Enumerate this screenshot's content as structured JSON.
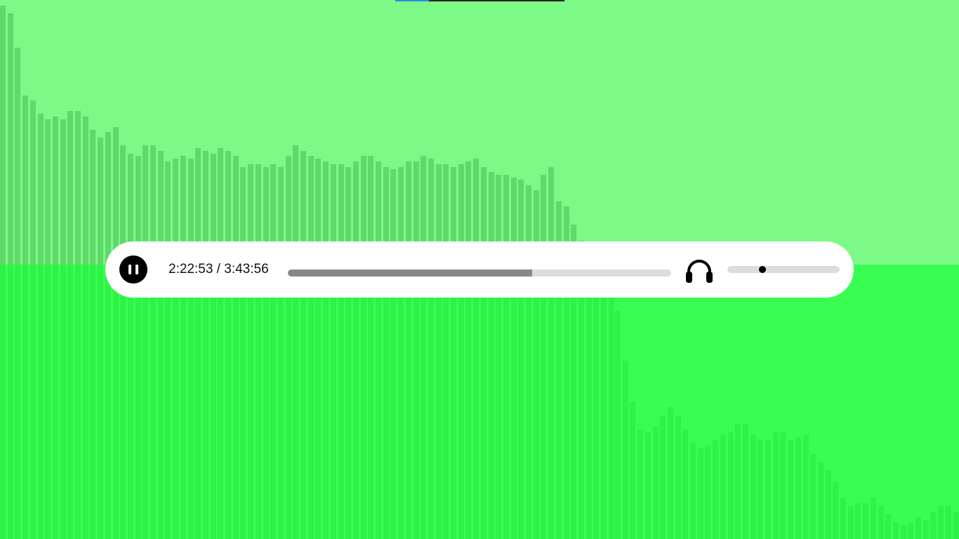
{
  "theme": {
    "bg_top": "#7cf987",
    "bg_bottom": "#3afd51",
    "bar_top": "#5fd96b",
    "bar_bottom": "#2ff247",
    "strip_accent": "#2b8be0",
    "strip_dark": "#222222",
    "player_bg": "#ffffff",
    "progress_track": "#dddddd",
    "progress_fill": "#888888"
  },
  "player": {
    "state": "playing",
    "button_icon": "pause-icon",
    "current_time": "2:22:53",
    "separator": " / ",
    "total_time": "3:43:56",
    "progress_fraction": 0.638,
    "output_icon": "headphones-icon",
    "volume_fraction": 0.31
  },
  "visualizer": {
    "top_levels": [
      0.98,
      0.95,
      0.82,
      0.64,
      0.62,
      0.57,
      0.55,
      0.56,
      0.55,
      0.58,
      0.58,
      0.56,
      0.51,
      0.48,
      0.5,
      0.52,
      0.45,
      0.42,
      0.41,
      0.45,
      0.45,
      0.43,
      0.39,
      0.4,
      0.41,
      0.4,
      0.44,
      0.43,
      0.42,
      0.44,
      0.43,
      0.41,
      0.37,
      0.38,
      0.38,
      0.37,
      0.38,
      0.37,
      0.41,
      0.45,
      0.43,
      0.41,
      0.4,
      0.39,
      0.38,
      0.38,
      0.37,
      0.39,
      0.41,
      0.41,
      0.39,
      0.37,
      0.36,
      0.37,
      0.39,
      0.39,
      0.41,
      0.4,
      0.38,
      0.38,
      0.37,
      0.38,
      0.39,
      0.4,
      0.37,
      0.35,
      0.34,
      0.34,
      0.33,
      0.32,
      0.3,
      0.28,
      0.34,
      0.37,
      0.24,
      0.22,
      0.15,
      0.09
    ],
    "bottom_levels": [
      0.83,
      0.65,
      0.5,
      0.4,
      0.39,
      0.41,
      0.45,
      0.48,
      0.45,
      0.4,
      0.35,
      0.33,
      0.34,
      0.36,
      0.38,
      0.39,
      0.42,
      0.42,
      0.38,
      0.36,
      0.36,
      0.39,
      0.39,
      0.36,
      0.37,
      0.38,
      0.31,
      0.28,
      0.25,
      0.21,
      0.15,
      0.12,
      0.13,
      0.13,
      0.15,
      0.12,
      0.09,
      0.06,
      0.05,
      0.06,
      0.08,
      0.07,
      0.1,
      0.12,
      0.12,
      0.1,
      0.08,
      0.05
    ]
  }
}
